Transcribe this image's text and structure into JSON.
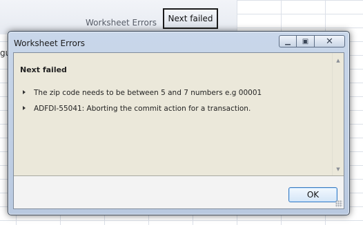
{
  "background": {
    "panel_title": "Worksheet Errors",
    "button_label": "Next failed",
    "left_fragment": "gu"
  },
  "dialog": {
    "title": "Worksheet Errors",
    "heading": "Next failed",
    "messages": [
      "The zip code needs to be between 5 and 7 numbers e.g 00001",
      "ADFDI-55041: Aborting the commit action for a transaction."
    ],
    "ok_label": "OK",
    "caption_buttons": {
      "minimize_icon": "minimize-icon",
      "maximize_icon": "maximize-icon",
      "close_icon": "close-icon"
    }
  }
}
